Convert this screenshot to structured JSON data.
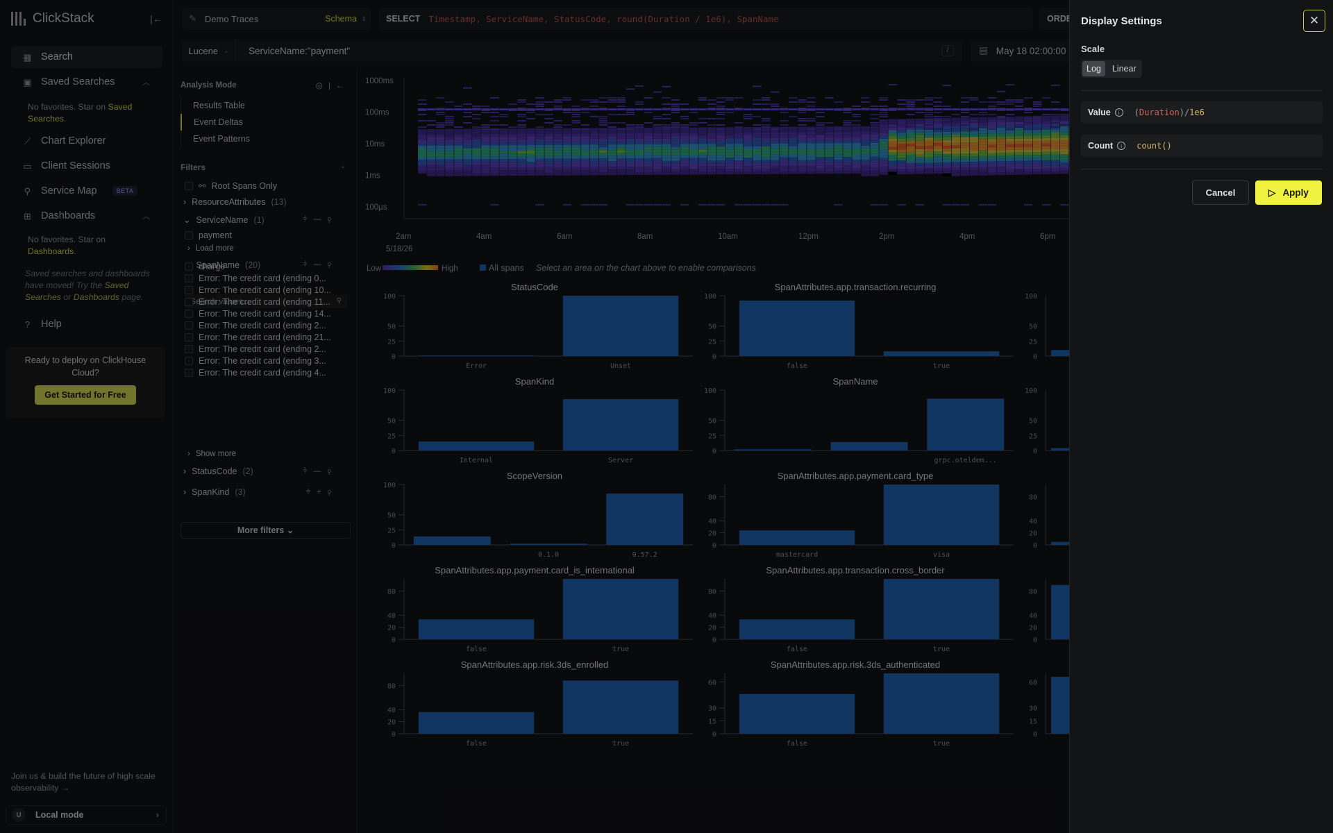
{
  "app": {
    "name": "ClickStack"
  },
  "nav": {
    "search": "Search",
    "saved_searches": "Saved Searches",
    "saved_note_prefix": "No favorites. Star on ",
    "saved_note_link": "Saved Searches",
    "saved_note_suffix": ".",
    "chart_explorer": "Chart Explorer",
    "client_sessions": "Client Sessions",
    "service_map": "Service Map",
    "service_map_badge": "BETA",
    "dashboards": "Dashboards",
    "dash_note_prefix": "No favorites. Star on ",
    "dash_note_link": "Dashboards",
    "dash_note_suffix": ".",
    "moved_a": "Saved searches and dashboards have moved! Try the ",
    "moved_link1": "Saved Searches",
    "moved_b": " or ",
    "moved_link2": "Dashboards",
    "moved_c": " page.",
    "help": "Help"
  },
  "deploy": {
    "text": "Ready to deploy on ClickHouse Cloud?",
    "button": "Get Started for Free"
  },
  "footer": {
    "join": "Join us & build the future of high scale observability →",
    "user_initial": "U",
    "mode": "Local mode"
  },
  "source": {
    "name": "Demo Traces",
    "schema": "Schema"
  },
  "sql": {
    "select_kw": "SELECT",
    "select_expr": "Timestamp, ServiceName, StatusCode, round(Duration / 1e6), SpanName",
    "order_kw": "ORDER"
  },
  "query": {
    "language": "Lucene",
    "text": "ServiceName:\"payment\"",
    "shortcut": "/"
  },
  "time": {
    "range": "May 18 02:00:00"
  },
  "analysis": {
    "title": "Analysis Mode",
    "modes": [
      "Results Table",
      "Event Deltas",
      "Event Patterns"
    ],
    "selected_mode": "Event Deltas"
  },
  "filters": {
    "title": "Filters",
    "root_spans": "Root Spans Only",
    "resource_attr": "ResourceAttributes",
    "resource_attr_count": "(13)",
    "service_name": "ServiceName",
    "service_name_count": "(1)",
    "service_values": [
      "payment"
    ],
    "load_more": "Load more",
    "span_name": "SpanName",
    "span_name_count": "(20)",
    "search_placeholder": "Search values...",
    "span_values": [
      "charge",
      "Error: The credit card (ending 0...",
      "Error: The credit card (ending 10...",
      "Error: The credit card (ending 11...",
      "Error: The credit card (ending 14...",
      "Error: The credit card (ending 2...",
      "Error: The credit card (ending 21...",
      "Error: The credit card (ending 2...",
      "Error: The credit card (ending 3...",
      "Error: The credit card (ending 4..."
    ],
    "show_more": "Show more",
    "status_code": "StatusCode",
    "status_code_count": "(2)",
    "span_kind": "SpanKind",
    "span_kind_count": "(3)",
    "more_filters": "More filters"
  },
  "heatmap": {
    "y_ticks": [
      "1000ms",
      "100ms",
      "10ms",
      "1ms",
      "100µs"
    ],
    "x_ticks": [
      "2am",
      "4am",
      "6am",
      "8am",
      "10am",
      "12pm",
      "2pm",
      "4pm",
      "6pm"
    ],
    "date": "5/18/26",
    "legend_low": "Low",
    "legend_high": "High",
    "legend_all": "All spans",
    "hint": "Select an area on the chart above to enable comparisons"
  },
  "chart_data": [
    {
      "type": "bar",
      "title": "StatusCode",
      "categories": [
        "Error",
        "Unset"
      ],
      "values": [
        1,
        100
      ],
      "yticks": [
        0,
        25,
        50,
        100
      ],
      "ylim": [
        0,
        100
      ]
    },
    {
      "type": "bar",
      "title": "SpanAttributes.app.transaction.recurring",
      "categories": [
        "false",
        "true"
      ],
      "values": [
        92,
        8
      ],
      "yticks": [
        0,
        25,
        50,
        100
      ],
      "ylim": [
        0,
        100
      ]
    },
    {
      "type": "bar",
      "title": "SpanKind",
      "categories": [
        "Internal",
        "Server"
      ],
      "values": [
        15,
        85
      ],
      "yticks": [
        0,
        25,
        50,
        100
      ],
      "ylim": [
        0,
        100
      ]
    },
    {
      "type": "bar",
      "title": "SpanName",
      "categories": [
        "",
        "",
        "grpc.oteldem..."
      ],
      "values": [
        2,
        14,
        86
      ],
      "yticks": [
        0,
        25,
        50,
        100
      ],
      "ylim": [
        0,
        100
      ]
    },
    {
      "type": "bar",
      "title": "ScopeVersion",
      "categories": [
        "",
        "0.1.0",
        "0.57.2"
      ],
      "values": [
        14,
        2,
        85
      ],
      "yticks": [
        0,
        25,
        50,
        100
      ],
      "ylim": [
        0,
        100
      ]
    },
    {
      "type": "bar",
      "title": "SpanAttributes.app.payment.card_type",
      "categories": [
        "mastercard",
        "visa"
      ],
      "values": [
        24,
        100
      ],
      "yticks": [
        0,
        20,
        40,
        80
      ],
      "ylim": [
        0,
        100
      ]
    },
    {
      "type": "bar",
      "title": "SpanAttributes.app.payment.card_is_international",
      "categories": [
        "false",
        "true"
      ],
      "values": [
        33,
        100
      ],
      "yticks": [
        0,
        20,
        40,
        80
      ],
      "ylim": [
        0,
        100
      ]
    },
    {
      "type": "bar",
      "title": "SpanAttributes.app.transaction.cross_border",
      "categories": [
        "false",
        "true"
      ],
      "values": [
        33,
        100
      ],
      "yticks": [
        0,
        20,
        40,
        80
      ],
      "ylim": [
        0,
        100
      ]
    },
    {
      "type": "bar",
      "title": "SpanAttributes.app.risk.3ds_enrolled",
      "categories": [
        "false",
        "true"
      ],
      "values": [
        36,
        88
      ],
      "yticks": [
        0,
        20,
        40,
        80
      ],
      "ylim": [
        0,
        100
      ]
    },
    {
      "type": "bar",
      "title": "SpanAttributes.app.risk.3ds_authenticated",
      "categories": [
        "false",
        "true"
      ],
      "values": [
        46,
        70
      ],
      "yticks": [
        0,
        15,
        30,
        60
      ],
      "ylim": [
        0,
        70
      ]
    }
  ],
  "partial_charts": [
    {
      "yticks": [
        0,
        25,
        50,
        100
      ],
      "value": 10,
      "ymax": 100
    },
    {
      "yticks": [
        0,
        25,
        50,
        100
      ],
      "value": 4,
      "ymax": 100
    },
    {
      "yticks": [
        0,
        20,
        40,
        80
      ],
      "value": 5,
      "ymax": 100
    },
    {
      "yticks": [
        0,
        20,
        40,
        80
      ],
      "value": 90,
      "ymax": 100
    },
    {
      "yticks": [
        0,
        15,
        30,
        60
      ],
      "value": 66,
      "ymax": 70
    }
  ],
  "drawer": {
    "title": "Display Settings",
    "scale_label": "Scale",
    "scale_options": [
      "Log",
      "Linear"
    ],
    "scale_selected": "Log",
    "value_label": "Value",
    "value_expr_paren_open": "(",
    "value_expr_id": "Duration",
    "value_expr_paren_close": ")/",
    "value_expr_num": "1e6",
    "count_label": "Count",
    "count_expr": "count()",
    "cancel": "Cancel",
    "apply": "Apply"
  },
  "colors": {
    "accent": "#c6c94d",
    "apply": "#f1f23f",
    "bar": "#1e5ea8",
    "heat_low": "#4b3a9e",
    "heat_high": "#e8a23a"
  }
}
